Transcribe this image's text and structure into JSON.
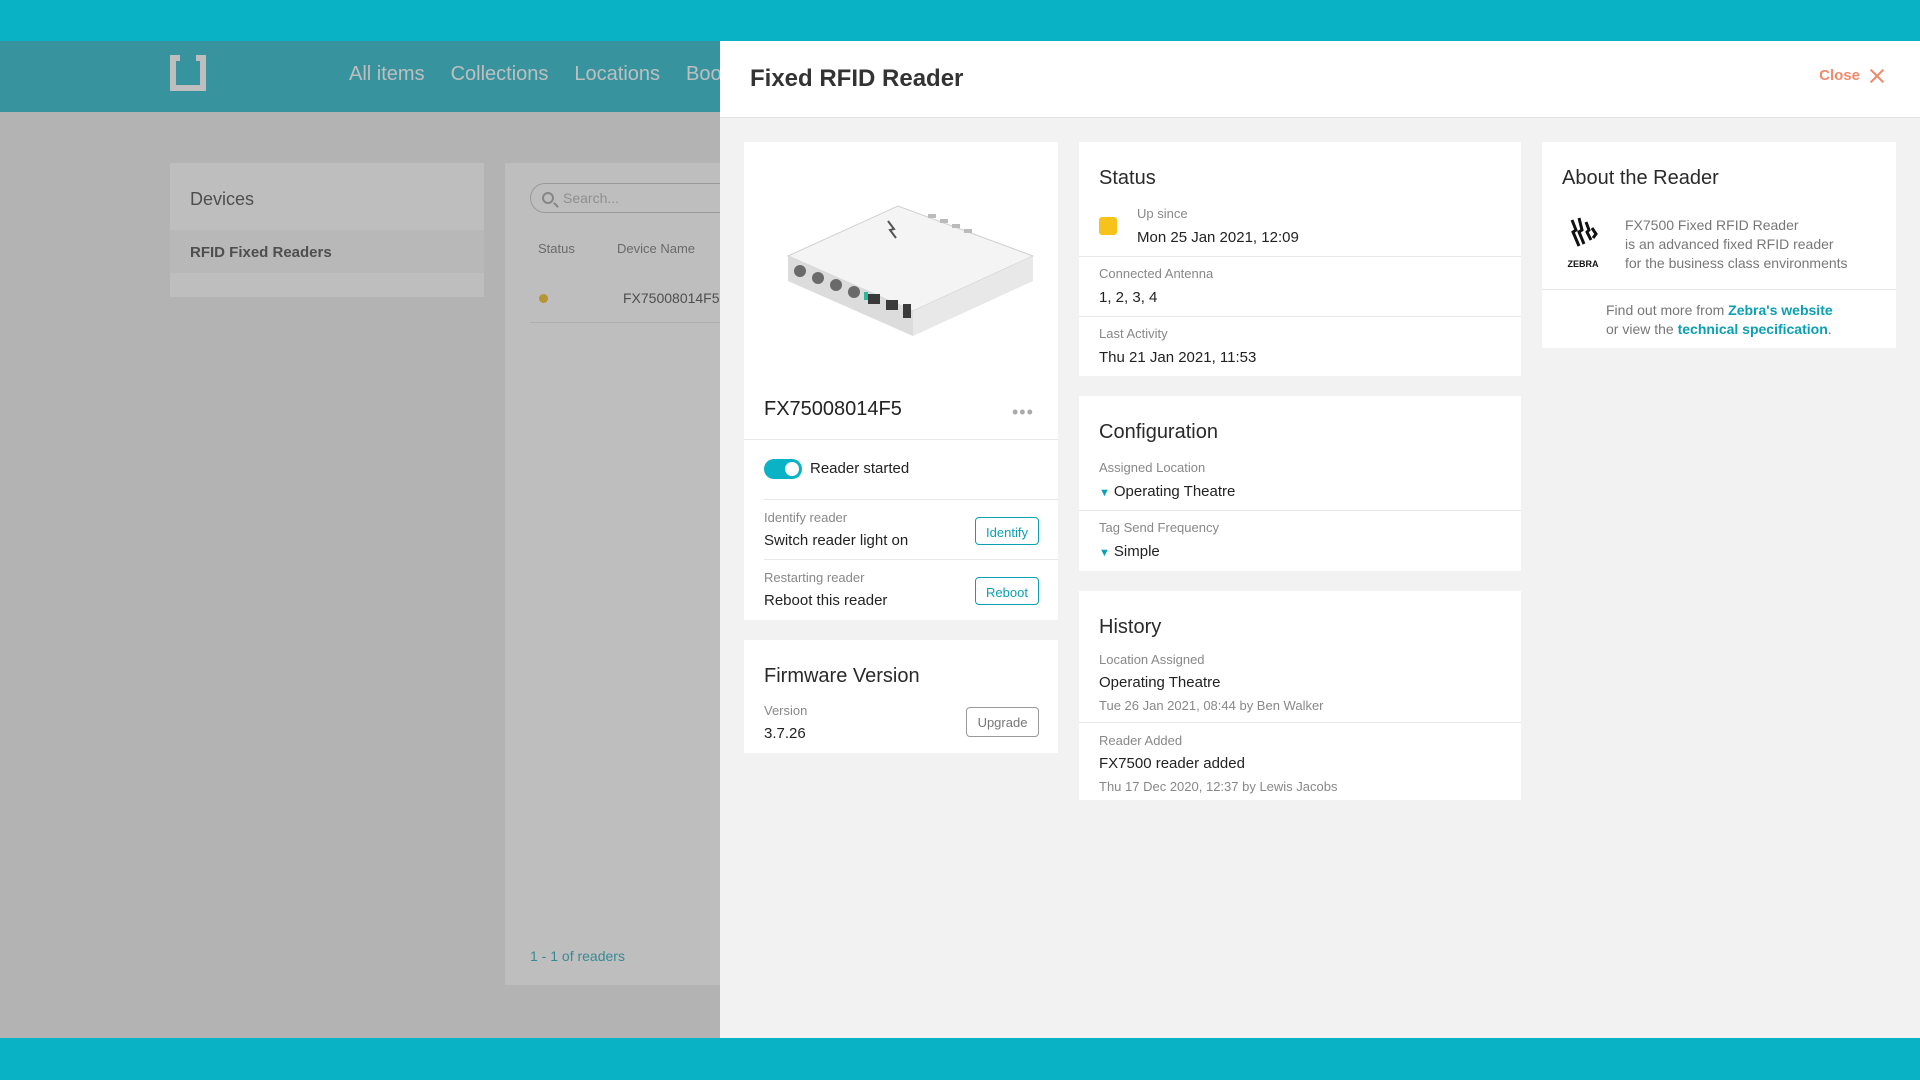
{
  "app": {
    "nav": [
      "All items",
      "Collections",
      "Locations",
      "Boo"
    ],
    "devices": {
      "title": "Devices",
      "item": "RFID Fixed Readers"
    },
    "list": {
      "search_placeholder": "Search...",
      "columns": [
        "Status",
        "Device Name"
      ],
      "rows": [
        {
          "name": "FX75008014F5"
        }
      ],
      "pager": "1 - 1 of readers"
    }
  },
  "panel": {
    "title": "Fixed RFID Reader",
    "close_label": "Close",
    "device": {
      "name": "FX75008014F5",
      "more": "•••",
      "toggle_label": "Reader started",
      "identify": {
        "label": "Identify reader",
        "value": "Switch reader light on",
        "button": "Identify"
      },
      "restart": {
        "label": "Restarting reader",
        "value": "Reboot this reader",
        "button": "Reboot"
      }
    },
    "firmware": {
      "title": "Firmware Version",
      "label": "Version",
      "value": "3.7.26",
      "button": "Upgrade"
    },
    "status": {
      "title": "Status",
      "up_since_label": "Up since",
      "up_since_value": "Mon 25 Jan 2021, 12:09",
      "antenna_label": "Connected Antenna",
      "antenna_value": "1, 2, 3, 4",
      "activity_label": "Last Activity",
      "activity_value": "Thu 21 Jan 2021, 11:53",
      "status_color": "#f7c21a"
    },
    "configuration": {
      "title": "Configuration",
      "location_label": "Assigned Location",
      "location_value": "Operating Theatre",
      "frequency_label": "Tag Send Frequency",
      "frequency_value": "Simple"
    },
    "history": {
      "title": "History",
      "items": [
        {
          "label": "Location Assigned",
          "value": "Operating Theatre",
          "meta": "Tue 26 Jan 2021, 08:44 by Ben Walker"
        },
        {
          "label": "Reader Added",
          "value": "FX7500 reader added",
          "meta": "Thu 17 Dec 2020, 12:37 by Lewis Jacobs"
        }
      ]
    },
    "about": {
      "title": "About the Reader",
      "logo_text": "ZEBRA",
      "desc": [
        "FX7500 Fixed RFID Reader",
        "is an advanced fixed RFID reader",
        "for the business class environments"
      ],
      "more_prefix": "Find out more from ",
      "more_link": "Zebra's website",
      "view_prefix": "or view the ",
      "view_link": "technical specification",
      "view_suffix": "."
    }
  },
  "colors": {
    "accent": "#0ab2c6",
    "close": "#f08a6c",
    "status_warning": "#f7c21a"
  }
}
